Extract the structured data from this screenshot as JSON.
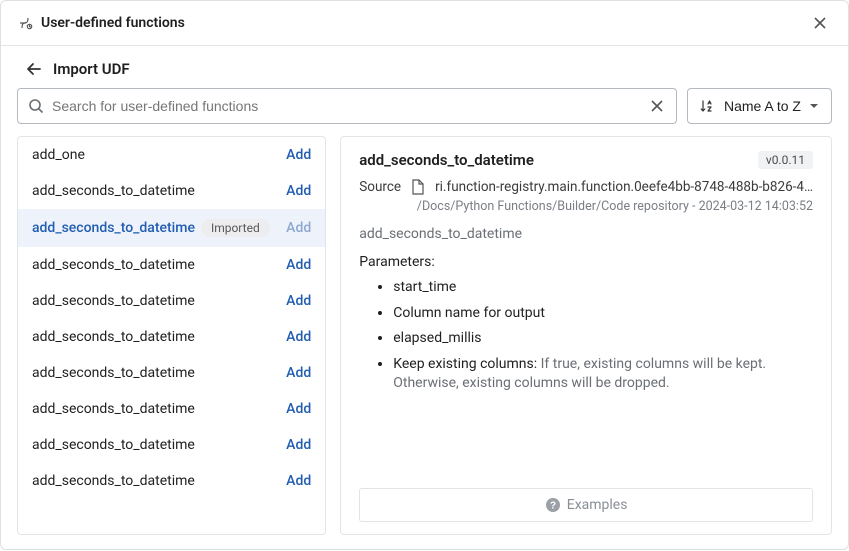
{
  "header": {
    "title": "User-defined functions"
  },
  "subheader": {
    "title": "Import UDF"
  },
  "search": {
    "placeholder": "Search for user-defined functions",
    "value": ""
  },
  "sort": {
    "label": "Name A to Z"
  },
  "list": {
    "items": [
      {
        "name": "add_one",
        "action": "Add",
        "imported": false,
        "selected": false
      },
      {
        "name": "add_seconds_to_datetime",
        "action": "Add",
        "imported": false,
        "selected": false
      },
      {
        "name": "add_seconds_to_datetime",
        "action": "Add",
        "imported": true,
        "selected": true
      },
      {
        "name": "add_seconds_to_datetime",
        "action": "Add",
        "imported": false,
        "selected": false
      },
      {
        "name": "add_seconds_to_datetime",
        "action": "Add",
        "imported": false,
        "selected": false
      },
      {
        "name": "add_seconds_to_datetime",
        "action": "Add",
        "imported": false,
        "selected": false
      },
      {
        "name": "add_seconds_to_datetime",
        "action": "Add",
        "imported": false,
        "selected": false
      },
      {
        "name": "add_seconds_to_datetime",
        "action": "Add",
        "imported": false,
        "selected": false
      },
      {
        "name": "add_seconds_to_datetime",
        "action": "Add",
        "imported": false,
        "selected": false
      },
      {
        "name": "add_seconds_to_datetime",
        "action": "Add",
        "imported": false,
        "selected": false
      }
    ],
    "imported_label": "Imported"
  },
  "detail": {
    "title": "add_seconds_to_datetime",
    "version": "v0.0.11",
    "source_label": "Source",
    "source_uri": "ri.function-registry.main.function.0eefe4bb-8748-488b-b826-4…",
    "source_path": "/Docs/Python Functions/Builder/Code repository - 2024-03-12 14:03:52",
    "subname": "add_seconds_to_datetime",
    "params_title": "Parameters:",
    "params": [
      {
        "text": "start_time"
      },
      {
        "text": "Column name for output"
      },
      {
        "text": "elapsed_millis"
      },
      {
        "text": "Keep existing columns: ",
        "hint": "If true, existing columns will be kept. Otherwise, existing columns will be dropped."
      }
    ],
    "examples_label": "Examples"
  }
}
